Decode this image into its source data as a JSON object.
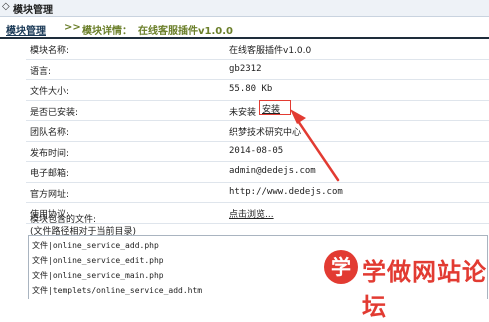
{
  "header": {
    "title": "模块管理"
  },
  "breadcrumb": {
    "home": "模块管理",
    "separator": ">>",
    "detail_label": "模块详情：",
    "module_name": "在线客服插件v1.0.0"
  },
  "details": [
    {
      "label": "模块名称:",
      "value": "在线客服插件v1.0.0"
    },
    {
      "label": "语言:",
      "value": "gb2312"
    },
    {
      "label": "文件大小:",
      "value": "55.80 Kb"
    },
    {
      "label": "是否已安装:",
      "value": "未安装"
    },
    {
      "label": "团队名称:",
      "value": "织梦技术研究中心"
    },
    {
      "label": "发布时间:",
      "value": "2014-08-05"
    },
    {
      "label": "电子邮箱:",
      "value": "admin@dedejs.com"
    },
    {
      "label": "官方网址:",
      "value": "http://www.dedejs.com"
    },
    {
      "label": "使用协议:",
      "value": "点击浏览..."
    }
  ],
  "install_link": "安装",
  "files": {
    "title": "模块包含的文件:",
    "subtitle": "(文件路径相对于当前目录)",
    "items": [
      "文件|online_service_add.php",
      "文件|online_service_edit.php",
      "文件|online_service_main.php",
      "文件|templets/online_service_add.htm"
    ]
  },
  "watermark": {
    "logo_char": "学",
    "text": "学做网站论坛"
  },
  "colors": {
    "annotation": "#e23b32",
    "accent_text": "#6b7f2a",
    "header_line": "#1e2d3b"
  }
}
